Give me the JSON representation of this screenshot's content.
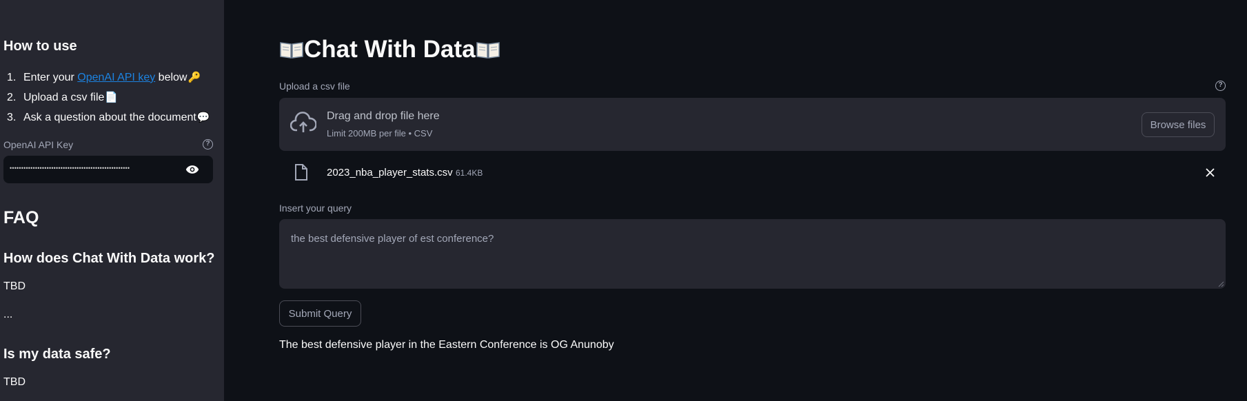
{
  "sidebar": {
    "how_to_use_heading": "How to use",
    "steps": [
      {
        "num": "1.",
        "prefix": "Enter your ",
        "link": "OpenAI API key",
        "suffix": " below",
        "emoji": "🔑"
      },
      {
        "num": "2.",
        "text": "Upload a csv file",
        "emoji": "📄"
      },
      {
        "num": "3.",
        "text": "Ask a question about the document",
        "emoji": "💬"
      }
    ],
    "api_key_label": "OpenAI API Key",
    "api_key_value": "••••••••••••••••••••••••••••••••••••••••••••••••••••",
    "faq_heading": "FAQ",
    "q1": "How does Chat With Data work?",
    "a1": "TBD",
    "ellipsis": "...",
    "q2": "Is my data safe?",
    "a2": "TBD"
  },
  "main": {
    "title": "Chat With Data",
    "upload_label": "Upload a csv file",
    "dropzone_title": "Drag and drop file here",
    "dropzone_sub": "Limit 200MB per file • CSV",
    "browse_label": "Browse files",
    "file_name": "2023_nba_player_stats.csv",
    "file_size": "61.4KB",
    "query_label": "Insert your query",
    "query_value": "the best defensive player of est conference?",
    "submit_label": "Submit Query",
    "answer": "The best defensive player in the Eastern Conference is OG Anunoby"
  },
  "colors": {
    "background": "#0e1117",
    "sidebar": "#262730",
    "link": "#1c83e1",
    "muted": "#a3a8b8"
  },
  "icons": [
    "help-icon",
    "eye-icon",
    "cloud-upload-icon",
    "file-icon",
    "close-icon",
    "book-icon",
    "key-icon",
    "page-icon",
    "speech-bubble-icon"
  ]
}
